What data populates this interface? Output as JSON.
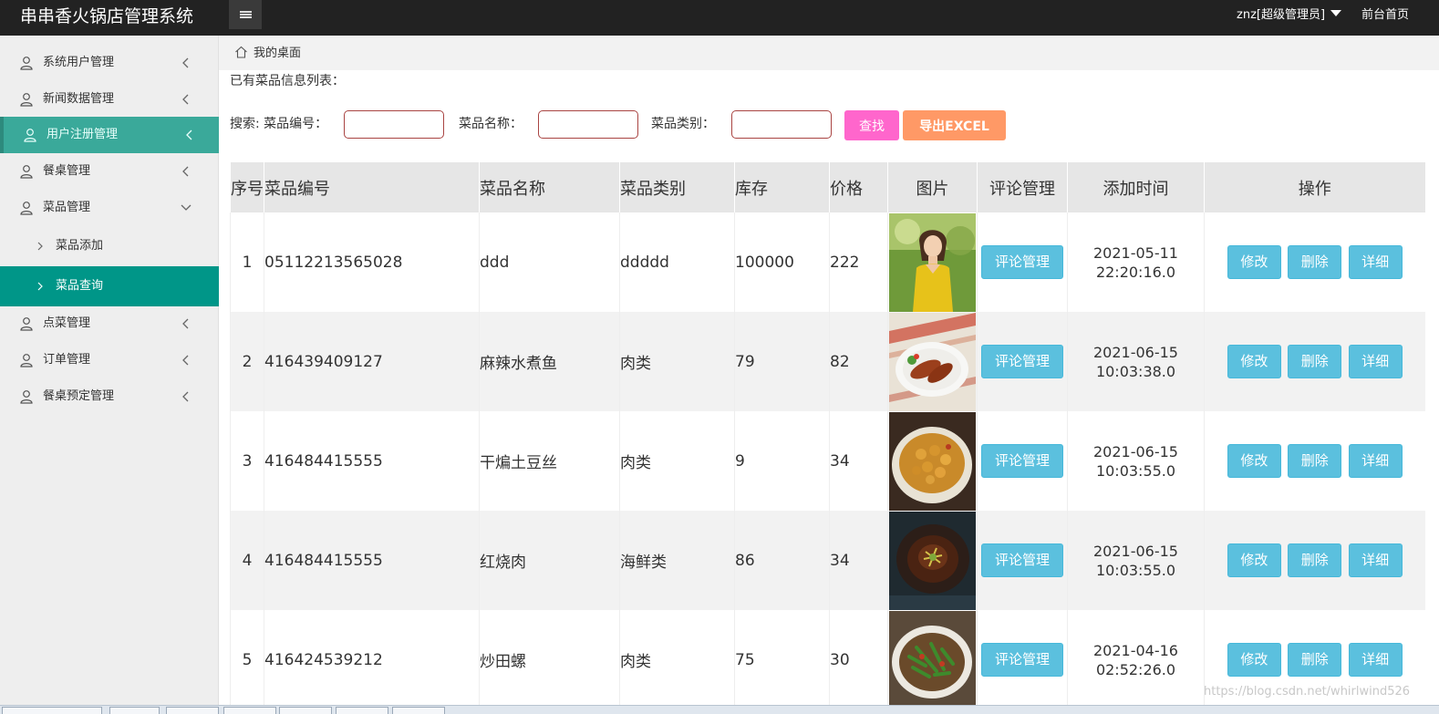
{
  "app": {
    "title": "串串香火锅店管理系统",
    "user": "znz[超级管理员]",
    "front_link": "前台首页"
  },
  "sidebar": {
    "items": [
      {
        "label": "系统用户管理"
      },
      {
        "label": "新闻数据管理"
      },
      {
        "label": "用户注册管理"
      },
      {
        "label": "餐桌管理"
      },
      {
        "label": "菜品管理"
      },
      {
        "label": "菜品添加"
      },
      {
        "label": "菜品查询"
      },
      {
        "label": "点菜管理"
      },
      {
        "label": "订单管理"
      },
      {
        "label": "餐桌预定管理"
      }
    ]
  },
  "breadcrumb": {
    "label": "我的桌面"
  },
  "list_title": "已有菜品信息列表：",
  "search": {
    "prefix": "搜索: 菜品编号：",
    "name_label": "菜品名称：",
    "type_label": "菜品类别：",
    "code_value": "",
    "name_value": "",
    "type_value": "",
    "find_label": "查找",
    "export_label": "导出EXCEL"
  },
  "table": {
    "headers": [
      "序号",
      "菜品编号",
      "菜品名称",
      "菜品类别",
      "库存",
      "价格",
      "图片",
      "评论管理",
      "添加时间",
      "操作"
    ],
    "comment_label": "评论管理",
    "edit_label": "修改",
    "delete_label": "删除",
    "detail_label": "详细",
    "rows": [
      {
        "no": "1",
        "code": "05112213565028",
        "name": "ddd",
        "type": "ddddd",
        "stock": "100000",
        "price": "222",
        "date": "2021-05-11",
        "time": "22:20:16.0",
        "image": "woman-portrait-photo"
      },
      {
        "no": "2",
        "code": "416439409127",
        "name": "麻辣水煮鱼",
        "type": "肉类",
        "stock": "79",
        "price": "82",
        "date": "2021-06-15",
        "time": "10:03:38.0",
        "image": "fried-meat-dish-photo"
      },
      {
        "no": "3",
        "code": "416484415555",
        "name": "干煸土豆丝",
        "type": "肉类",
        "stock": "9",
        "price": "34",
        "date": "2021-06-15",
        "time": "10:03:55.0",
        "image": "fried-potato-dish-photo"
      },
      {
        "no": "4",
        "code": "416484415555",
        "name": "红烧肉",
        "type": "海鲜类",
        "stock": "86",
        "price": "34",
        "date": "2021-06-15",
        "time": "10:03:55.0",
        "image": "braised-dish-dark-bowl-photo"
      },
      {
        "no": "5",
        "code": "416424539212",
        "name": "炒田螺",
        "type": "肉类",
        "stock": "75",
        "price": "30",
        "date": "2021-04-16",
        "time": "02:52:26.0",
        "image": "green-vegetable-dish-photo"
      }
    ]
  },
  "watermark": "https://blog.csdn.net/whirlwind526",
  "colors": {
    "topbar": "#222222",
    "sidebar_active_parent": "#3aa99a",
    "sidebar_active": "#009688",
    "find_button": "#ff66cc",
    "export_button": "#ff9966",
    "action_button": "#5bc0de"
  }
}
